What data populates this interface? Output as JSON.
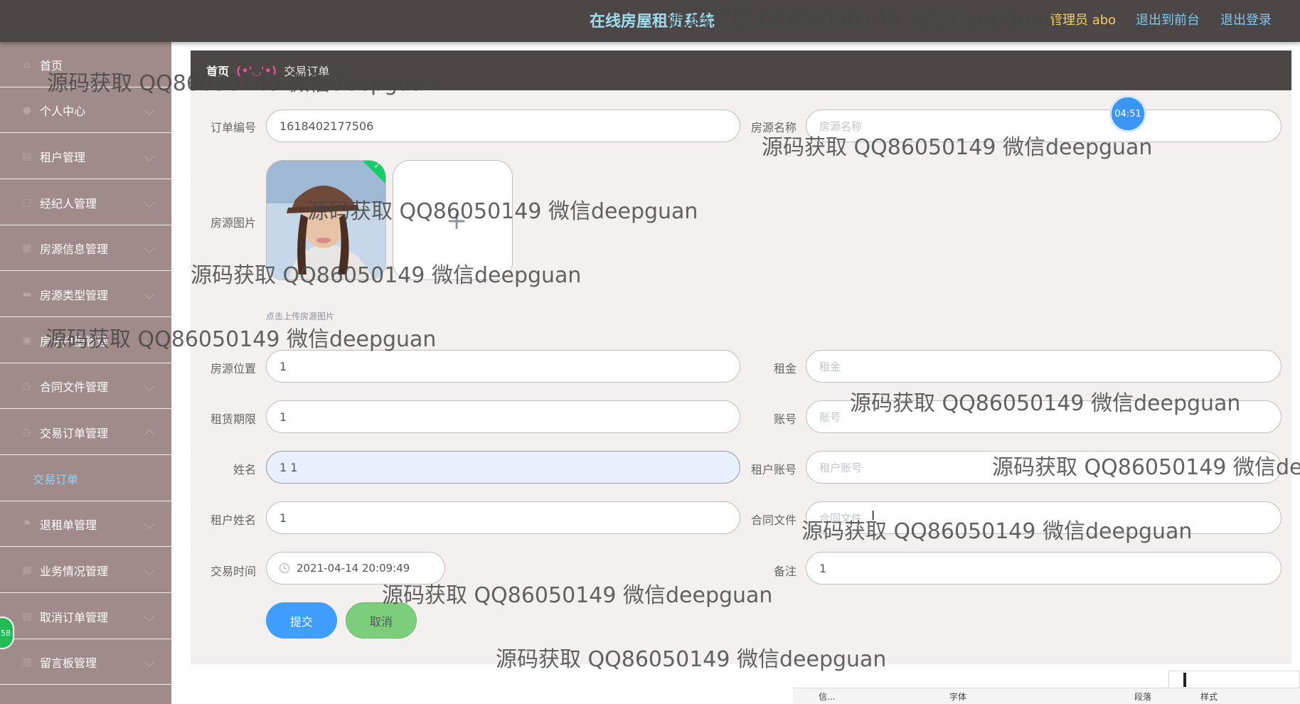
{
  "header": {
    "title": "在线房屋租赁系统",
    "user": "管理员 abo",
    "to_front": "退出到前台",
    "logout": "退出登录"
  },
  "sidebar": {
    "items": [
      {
        "label": "首页",
        "icon": "home-icon"
      },
      {
        "label": "个人中心",
        "icon": "user-icon"
      },
      {
        "label": "租户管理",
        "icon": "list-icon"
      },
      {
        "label": "经纪人管理",
        "icon": "box-icon"
      },
      {
        "label": "房源信息管理",
        "icon": "doc-icon"
      },
      {
        "label": "房源类型管理",
        "icon": "monitor-icon"
      },
      {
        "label": "房子户型管理",
        "icon": "briefcase-icon"
      },
      {
        "label": "合同文件管理",
        "icon": "clock-icon"
      },
      {
        "label": "交易订单管理",
        "icon": "clock-icon"
      },
      {
        "label": "退租单管理",
        "icon": "flag-icon"
      },
      {
        "label": "业务情况管理",
        "icon": "grid-icon"
      },
      {
        "label": "取消订单管理",
        "icon": "doc-icon"
      },
      {
        "label": "留言板管理",
        "icon": "chart-icon"
      }
    ],
    "active_sub": "交易订单"
  },
  "breadcrumb": {
    "home": "首页",
    "sep": "(•'◡'•)",
    "current": "交易订单"
  },
  "form": {
    "order_no": {
      "label": "订单编号",
      "value": "1618402177506"
    },
    "house_name": {
      "label": "房源名称",
      "placeholder": "房源名称"
    },
    "house_image": {
      "label": "房源图片",
      "tip": "点击上传房源图片",
      "plus": "+"
    },
    "location": {
      "label": "房源位置",
      "value": "1"
    },
    "rent": {
      "label": "租金",
      "placeholder": "租金"
    },
    "term": {
      "label": "租赁期限",
      "value": "1"
    },
    "account": {
      "label": "账号",
      "placeholder": "账号"
    },
    "name": {
      "label": "姓名",
      "value": "1 1"
    },
    "tenant_account": {
      "label": "租户账号",
      "placeholder": "租户账号"
    },
    "tenant_name": {
      "label": "租户姓名",
      "value": "1"
    },
    "contract": {
      "label": "合同文件",
      "placeholder": "合同文件"
    },
    "trade_time": {
      "label": "交易时间",
      "value": "2021-04-14 20:09:49"
    },
    "remark": {
      "label": "备注",
      "value": "1"
    },
    "submit": "提交",
    "cancel": "取消"
  },
  "overlay": {
    "timer": "04:51",
    "left_badge": "58",
    "upload_check": "✓",
    "word_toolbar": [
      "信...",
      "字体",
      "段落",
      "样式"
    ]
  },
  "watermark": "源码获取 QQ86050149 微信deepguan"
}
